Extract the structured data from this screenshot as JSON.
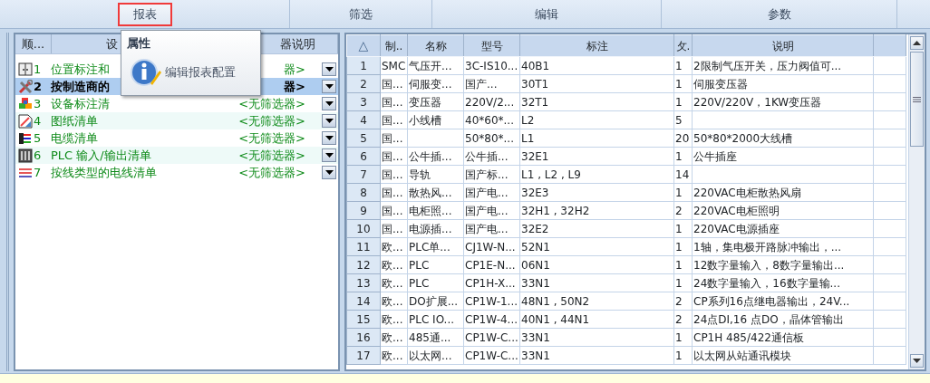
{
  "ribbon_groups": [
    {
      "label": "报表",
      "highlighted": true
    },
    {
      "label": "筛选",
      "highlighted": false
    },
    {
      "label": "编辑",
      "highlighted": false
    },
    {
      "label": "参数",
      "highlighted": false
    }
  ],
  "report_list": {
    "columns": [
      "顺...",
      "设",
      "器说明"
    ],
    "rows": [
      {
        "number": "1",
        "name": "位置标注和",
        "filter": "器>",
        "selected": false,
        "kind": "location"
      },
      {
        "number": "2",
        "name": "按制造商的",
        "filter": "器>",
        "selected": true,
        "kind": "tools"
      },
      {
        "number": "3",
        "name": "设备标注清",
        "filter": "<无筛选器>",
        "selected": false,
        "kind": "cubes"
      },
      {
        "number": "4",
        "name": "图纸清单",
        "filter": "<无筛选器>",
        "selected": false,
        "kind": "drawing"
      },
      {
        "number": "5",
        "name": "电缆清单",
        "filter": "<无筛选器>",
        "selected": false,
        "kind": "cable"
      },
      {
        "number": "6",
        "name": "PLC 输入/输出清单",
        "filter": "<无筛选器>",
        "selected": false,
        "kind": "plc"
      },
      {
        "number": "7",
        "name": "按线类型的电线清单",
        "filter": "<无筛选器>",
        "selected": false,
        "kind": "wires"
      }
    ]
  },
  "popup": {
    "title": "属性",
    "item": "编辑报表配置"
  },
  "parts_table": {
    "columns": [
      "△",
      "制..",
      "名称",
      "型号",
      "标注",
      "攵.",
      "说明"
    ],
    "rows": [
      [
        "1",
        "SMC",
        "气压开...",
        "3C-IS10...",
        "40B1",
        "1",
        "2限制气压开关，压力阀值可..."
      ],
      [
        "2",
        "国...",
        "伺服变...",
        "国产...",
        "30T1",
        "1",
        "伺服变压器"
      ],
      [
        "3",
        "国...",
        "变压器",
        "220V/2...",
        "32T1",
        "1",
        "220V/220V，1KW变压器"
      ],
      [
        "4",
        "国...",
        "小线槽",
        "40*60*...",
        "L2",
        "5",
        ""
      ],
      [
        "5",
        "国...",
        "",
        "50*80*...",
        "L1",
        "20",
        "50*80*2000大线槽"
      ],
      [
        "6",
        "国...",
        "公牛插...",
        "公牛插...",
        "32E1",
        "1",
        "公牛插座"
      ],
      [
        "7",
        "国...",
        "导轨",
        "国产标...",
        "L1 , L2 , L9",
        "14",
        ""
      ],
      [
        "8",
        "国...",
        "散热风...",
        "国产电...",
        "32E3",
        "1",
        "220VAC电柜散热风扇"
      ],
      [
        "9",
        "国...",
        "电柜照...",
        "国产电...",
        "32H1 , 32H2",
        "2",
        "220VAC电柜照明"
      ],
      [
        "10",
        "国...",
        "电源插...",
        "国产电...",
        "32E2",
        "1",
        "220VAC电源插座"
      ],
      [
        "11",
        "欧...",
        "PLC单...",
        "CJ1W-N...",
        "52N1",
        "1",
        "1轴，集电极开路脉冲输出，..."
      ],
      [
        "12",
        "欧...",
        "PLC",
        "CP1E-N...",
        "06N1",
        "1",
        "12数字量输入，8数字量输出..."
      ],
      [
        "13",
        "欧...",
        "PLC",
        "CP1H-X...",
        "33N1",
        "1",
        "24数字量输入，16数字量输..."
      ],
      [
        "14",
        "欧...",
        "DO扩展...",
        "CP1W-1...",
        "48N1 , 50N2",
        "2",
        "CP系列16点继电器输出，24V..."
      ],
      [
        "15",
        "欧...",
        "PLC  IO...",
        "CP1W-4...",
        "40N1 , 44N1",
        "2",
        "24点DI,16 点DO，晶体管输出"
      ],
      [
        "16",
        "欧...",
        "485通...",
        "CP1W-C...",
        "33N1",
        "1",
        "CP1H 485/422通信板"
      ],
      [
        "17",
        "欧...",
        "以太网...",
        "CP1W-C...",
        "33N1",
        "1",
        "以太网从站通讯模块"
      ]
    ]
  }
}
